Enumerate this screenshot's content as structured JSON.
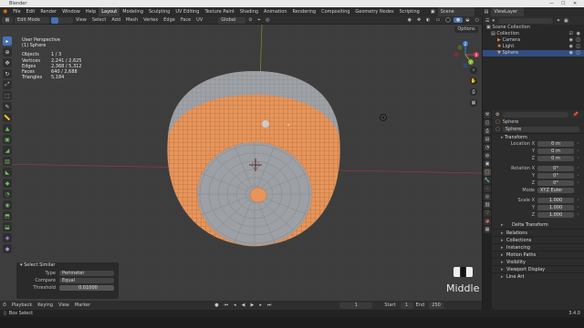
{
  "window": {
    "title": "Blender"
  },
  "menu": [
    "File",
    "Edit",
    "Render",
    "Window",
    "Help"
  ],
  "workspaces": [
    "Layout",
    "Modeling",
    "Sculpting",
    "UV Editing",
    "Texture Paint",
    "Shading",
    "Animation",
    "Rendering",
    "Compositing",
    "Geometry Nodes",
    "Scripting"
  ],
  "active_workspace": "Layout",
  "scene": {
    "name": "Scene",
    "view_layer": "ViewLayer"
  },
  "viewport_header": {
    "mode": "Edit Mode",
    "menus": [
      "View",
      "Select",
      "Add",
      "Mesh",
      "Vertex",
      "Edge",
      "Face",
      "UV"
    ],
    "orientation": "Global",
    "options": "Options"
  },
  "viewport_info": {
    "view": "User Perspective",
    "object": "(1) Sphere",
    "stats": [
      {
        "k": "Objects",
        "v": "1 / 3"
      },
      {
        "k": "Vertices",
        "v": "2,241 / 2,625"
      },
      {
        "k": "Edges",
        "v": "2,368 / 5,312"
      },
      {
        "k": "Faces",
        "v": "640 / 2,688"
      },
      {
        "k": "Triangles",
        "v": "5,184"
      }
    ]
  },
  "gizmo": {
    "x": "X",
    "y": "Y",
    "z": "Z",
    "x_color": "#d0384b",
    "y_color": "#7fb32a",
    "z_color": "#3b7ad0"
  },
  "select_similar": {
    "title": "Select Similar",
    "type_label": "Type",
    "type_value": "Perimeter",
    "compare_label": "Compare",
    "compare_value": "Equal",
    "threshold_label": "Threshold",
    "threshold_value": "0.01000"
  },
  "mouse_hint": "Middle",
  "timeline": {
    "items": [
      "Playback",
      "Keying",
      "View",
      "Marker"
    ],
    "current": "1",
    "start_label": "Start",
    "start": "1",
    "end_label": "End",
    "end": "250"
  },
  "status": {
    "left": "Box Select",
    "right": "3.4.0"
  },
  "outliner": {
    "rows": [
      {
        "label": "Scene Collection",
        "icon": "scene-collection-icon"
      },
      {
        "label": "Collection",
        "icon": "collection-icon"
      },
      {
        "label": "Camera",
        "icon": "camera-icon"
      },
      {
        "label": "Light",
        "icon": "light-icon"
      },
      {
        "label": "Sphere",
        "icon": "mesh-icon"
      }
    ]
  },
  "properties": {
    "object_name": "Sphere",
    "data_name": "Sphere",
    "transform_label": "Transform",
    "location_label": "Location X",
    "location": [
      "0 m",
      "0 m",
      "0 m"
    ],
    "rotation_label": "Rotation X",
    "rotation": [
      "0°",
      "0°",
      "0°"
    ],
    "mode_label": "Mode",
    "mode_value": "XYZ Euler",
    "scale_label": "Scale X",
    "scale": [
      "1.000",
      "1.000",
      "1.000"
    ],
    "axis_y": "Y",
    "axis_z": "Z",
    "panels": [
      "Delta Transform",
      "Relations",
      "Collections",
      "Instancing",
      "Motion Paths",
      "Visibility",
      "Viewport Display",
      "Line Art"
    ]
  },
  "colors": {
    "accent": "#4772b3",
    "selected_face": "#e88f4d",
    "mesh_base": "#9da0a5"
  }
}
